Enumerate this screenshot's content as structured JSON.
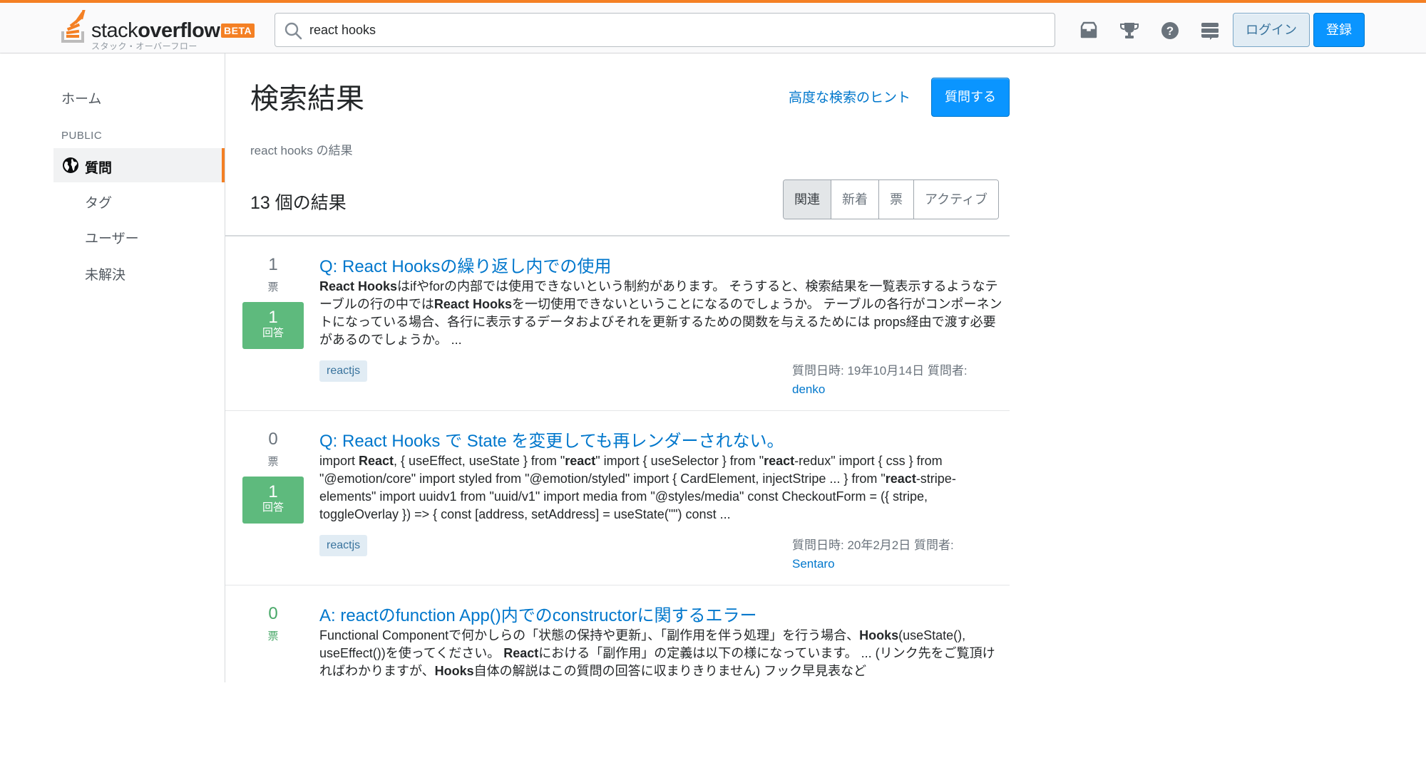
{
  "header": {
    "logo_word_light": "stack",
    "logo_word_bold": "overflow",
    "logo_beta": "BETA",
    "logo_sub": "スタック・オーバーフロー",
    "search_value": "react hooks",
    "icons": [
      "inbox-icon",
      "trophy-icon",
      "help-icon",
      "site-switcher-icon"
    ],
    "login_label": "ログイン",
    "signup_label": "登録",
    "accent_color": "#f48024"
  },
  "sidebar": {
    "home": "ホーム",
    "section": "PUBLIC",
    "questions": "質問",
    "tags": "タグ",
    "users": "ユーザー",
    "unanswered": "未解決"
  },
  "main": {
    "title": "検索結果",
    "advanced_link": "高度な検索のヒント",
    "ask_button": "質問する",
    "result_for": "react hooks の結果",
    "result_count": "13 個の結果",
    "sort_tabs": [
      "関連",
      "新着",
      "票",
      "アクティブ"
    ],
    "sort_active": "関連"
  },
  "results": [
    {
      "votes": "1",
      "votes_label": "票",
      "answers": "1",
      "answers_label": "回答",
      "title": "Q: React Hooksの繰り返し内での使用",
      "tag": "reactjs",
      "meta": "質問日時: 19年10月14日 質問者:",
      "user": "denko"
    },
    {
      "votes": "0",
      "votes_label": "票",
      "answers": "1",
      "answers_label": "回答",
      "title": "Q: React Hooks で State を変更しても再レンダーされない。",
      "tag": "reactjs",
      "meta": "質問日時: 20年2月2日 質問者:",
      "user": "Sentaro"
    },
    {
      "votes": "0",
      "votes_label": "票",
      "title": "A: reactのfunction App()内でのconstructorに関するエラー"
    }
  ]
}
